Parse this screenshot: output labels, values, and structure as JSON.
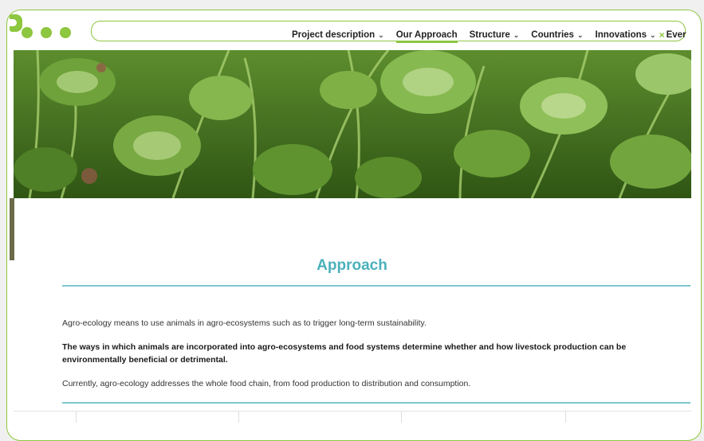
{
  "browser": {
    "accent_color": "#8dc63f",
    "window_controls": [
      "dot",
      "dot",
      "dot"
    ],
    "close_icon": "×"
  },
  "nav": {
    "items": [
      {
        "label": "Project description",
        "has_dropdown": true,
        "chevron": "⌄"
      },
      {
        "label": "Our Approach",
        "has_dropdown": false,
        "active": true
      },
      {
        "label": "Structure",
        "has_dropdown": true,
        "chevron": "⌄"
      },
      {
        "label": "Countries",
        "has_dropdown": true,
        "chevron": "⌄"
      },
      {
        "label": "Innovations",
        "has_dropdown": true,
        "chevron": "⌄"
      },
      {
        "label": "Ever",
        "has_dropdown": false
      }
    ]
  },
  "hero": {
    "image": "clover-and-grass-field",
    "colors": [
      "#3f6a1b",
      "#6fa23a",
      "#9cc66a",
      "#c8dfa2"
    ]
  },
  "content": {
    "title": "Approach",
    "title_color": "#4bb1bc",
    "paragraphs": [
      "Agro-ecology means to use animals in agro-ecosystems such as to trigger long-term sustainability.",
      "The ways in which animals are incorporated into agro-ecosystems and food systems determine whether and how livestock production can be environmentally beneficial or detrimental.",
      "Currently, agro-ecology addresses the whole food chain, from food production to distribution and consumption."
    ],
    "rule_color": "#7cc7cf"
  }
}
